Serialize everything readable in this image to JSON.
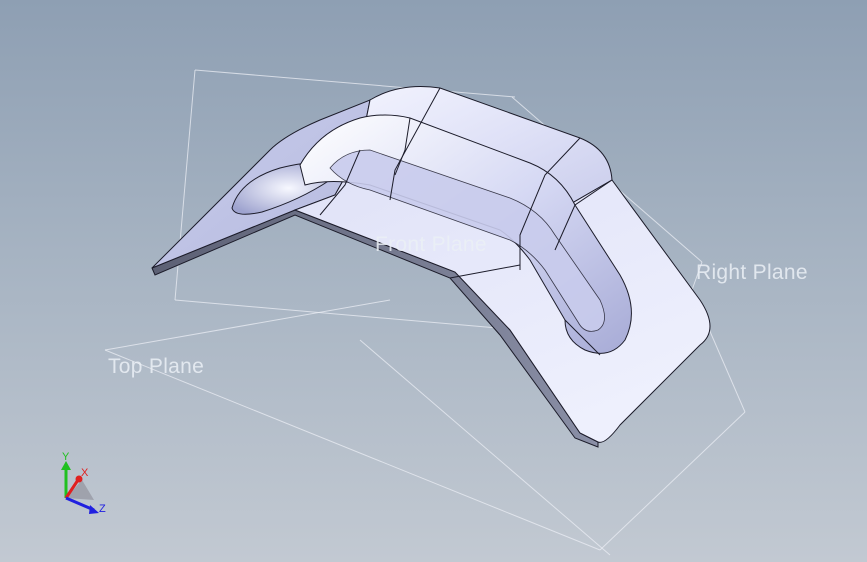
{
  "viewport": {
    "background_top": "#8e9fb3",
    "background_bottom": "#c2c9d2"
  },
  "model": {
    "part_color": "#d9dcf4",
    "edge_color": "#1c1c2a"
  },
  "planes": {
    "front": "Front Plane",
    "right": "Right Plane",
    "top": "Top Plane"
  },
  "triad": {
    "x": "X",
    "y": "Y",
    "z": "Z",
    "x_color": "#e02020",
    "y_color": "#20c020",
    "z_color": "#2020e0"
  }
}
